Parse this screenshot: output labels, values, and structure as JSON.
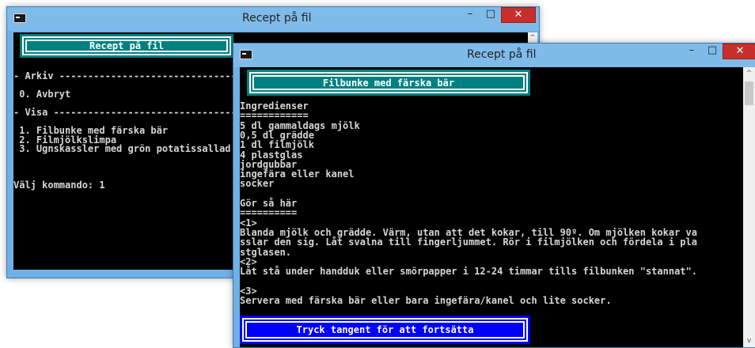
{
  "back_window": {
    "title": "Recept på fil",
    "banner": "Recept på fil",
    "lines": [
      "- Arkiv --------------------------------------",
      "",
      " 0. Avbryt",
      "",
      "- Visa ---------------------------------------",
      "",
      " 1. Filbunke med färska bär",
      " 2. Filmjölkslimpa",
      " 3. Ugnskassler med grön potatissallad",
      "",
      "",
      "",
      "Välj kommando: 1"
    ]
  },
  "front_window": {
    "title": "Recept på fil",
    "banner": "Filbunke med färska bär",
    "lines": [
      "Ingredienser",
      "============",
      "5 dl gammaldags mjölk",
      "0,5 dl grädde",
      "1 dl filmjölk",
      "4 plastglas",
      "jordgubbar",
      "ingefära eller kanel",
      "socker",
      "",
      "Gör så här",
      "==========",
      "<1>",
      "Blanda mjölk och grädde. Värm, utan att det kokar, till 90º. Om mjölken kokar va",
      "sslar den sig. Låt svalna till fingerljummet. Rör i filmjölken och fördela i pla",
      "stglasen.",
      "<2>",
      "Låt stå under handduk eller smörpapper i 12-24 timmar tills filbunken \"stannat\".",
      "",
      "<3>",
      "Servera med färska bär eller bara ingefära/kanel och lite socker."
    ],
    "prompt": "Tryck tangent för att fortsätta"
  },
  "window_controls": {
    "minimize": "–",
    "maximize": "□",
    "close": "✕"
  },
  "colors": {
    "title_bg": "#7fbbe9",
    "banner_teal": "#008080",
    "banner_blue": "#0000ff",
    "console_bg": "#000000",
    "console_fg": "#d6d6d6",
    "close_red": "#c7302a"
  }
}
